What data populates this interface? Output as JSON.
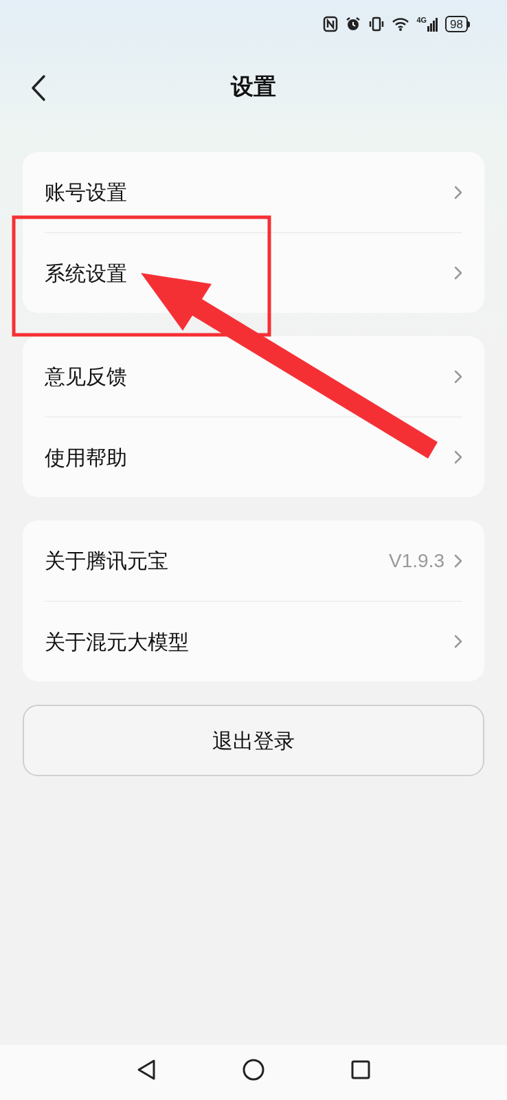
{
  "status_bar": {
    "network": "4G",
    "battery": "98"
  },
  "header": {
    "title": "设置"
  },
  "groups": [
    {
      "items": [
        {
          "label": "账号设置"
        },
        {
          "label": "系统设置"
        }
      ]
    },
    {
      "items": [
        {
          "label": "意见反馈"
        },
        {
          "label": "使用帮助"
        }
      ]
    },
    {
      "items": [
        {
          "label": "关于腾讯元宝",
          "value": "V1.9.3"
        },
        {
          "label": "关于混元大模型"
        }
      ]
    }
  ],
  "logout_button": {
    "label": "退出登录"
  }
}
